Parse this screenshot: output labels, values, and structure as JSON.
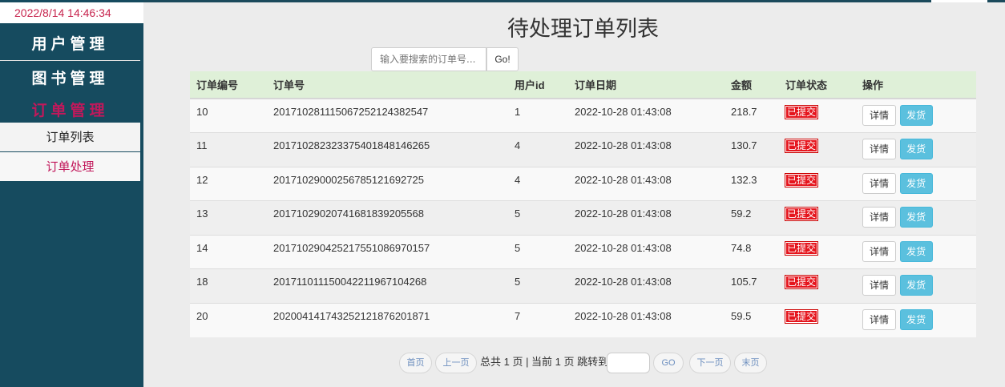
{
  "clock": "2022/8/14 14:46:34",
  "sidebar": {
    "menus": [
      "用户管理",
      "图书管理",
      "订单管理"
    ],
    "submenu": [
      "订单列表",
      "订单处理"
    ]
  },
  "page_title": "待处理订单列表",
  "search": {
    "placeholder": "输入要搜索的订单号...",
    "button": "Go!"
  },
  "table": {
    "headers": [
      "订单编号",
      "订单号",
      "用户id",
      "订单日期",
      "金额",
      "订单状态",
      "操作"
    ],
    "rows": [
      {
        "id": "10",
        "order_no": "20171028111506725212438254 7",
        "user": "1",
        "date": "2022-10-28 01:43:08",
        "amount": "218.7",
        "status": "已提交"
      },
      {
        "id": "11",
        "order_no": "201710282323375401848146265",
        "user": "4",
        "date": "2022-10-28 01:43:08",
        "amount": "130.7",
        "status": "已提交"
      },
      {
        "id": "12",
        "order_no": "20171029000256785121692725",
        "user": "4",
        "date": "2022-10-28 01:43:08",
        "amount": "132.3",
        "status": "已提交"
      },
      {
        "id": "13",
        "order_no": "20171029020741681839205568",
        "user": "5",
        "date": "2022-10-28 01:43:08",
        "amount": "59.2",
        "status": "已提交"
      },
      {
        "id": "14",
        "order_no": "201710290425217551086970157",
        "user": "5",
        "date": "2022-10-28 01:43:08",
        "amount": "74.8",
        "status": "已提交"
      },
      {
        "id": "18",
        "order_no": "20171101115004221196710426 8",
        "user": "5",
        "date": "2022-10-28 01:43:08",
        "amount": "105.7",
        "status": "已提交"
      },
      {
        "id": "20",
        "order_no": "20200414174325212187620187 1",
        "user": "7",
        "date": "2022-10-28 01:43:08",
        "amount": "59.5",
        "status": "已提交"
      }
    ],
    "actions": {
      "detail": "详情",
      "ship": "发货"
    }
  },
  "pager": {
    "first": "首页",
    "prev": "上一页",
    "summary": "总共 1 页 | 当前 1 页 跳转到",
    "go": "GO",
    "next": "下一页",
    "last": "末页"
  }
}
